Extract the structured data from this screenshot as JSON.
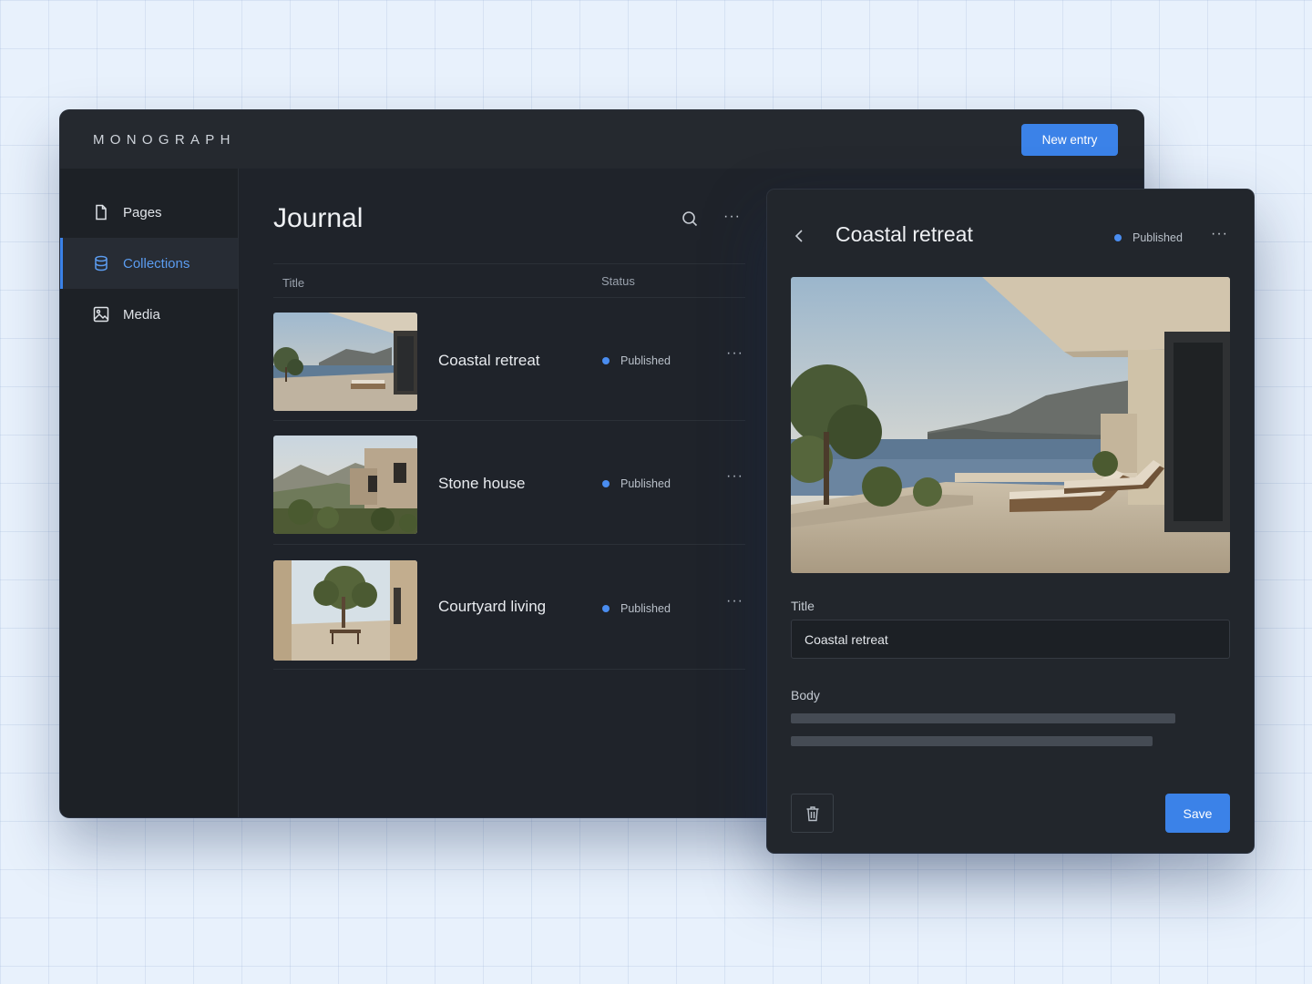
{
  "app": {
    "brand": "MONOGRAPH",
    "new_entry_label": "New entry"
  },
  "sidebar": {
    "items": [
      {
        "label": "Pages",
        "icon": "file-icon",
        "active": false
      },
      {
        "label": "Collections",
        "icon": "database-icon",
        "active": true
      },
      {
        "label": "Media",
        "icon": "image-icon",
        "active": false
      }
    ]
  },
  "main": {
    "title": "Journal",
    "columns": {
      "title": "Title",
      "status": "Status"
    },
    "rows": [
      {
        "title": "Coastal retreat",
        "status": "Published",
        "thumbnail": "coastal-terrace-image"
      },
      {
        "title": "Stone house",
        "status": "Published",
        "thumbnail": "stone-house-image"
      },
      {
        "title": "Courtyard living",
        "status": "Published",
        "thumbnail": "courtyard-image"
      }
    ],
    "more_glyph": "···"
  },
  "panel": {
    "title": "Coastal retreat",
    "status": "Published",
    "more_glyph": "···",
    "title_label": "Title",
    "title_value": "Coastal retreat",
    "body_label": "Body",
    "save_label": "Save"
  },
  "colors": {
    "accent": "#3b82e8",
    "status_dot": "#4a8df0",
    "window_bg": "#1f232a",
    "page_bg": "#e8f1fc"
  }
}
